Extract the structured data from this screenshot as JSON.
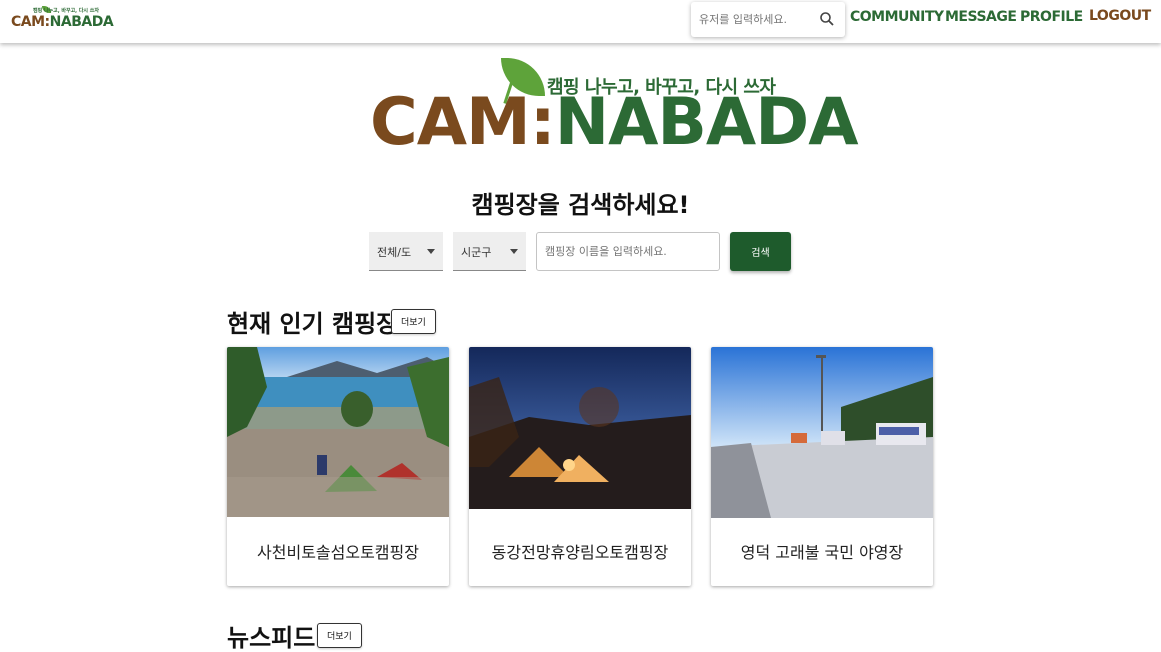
{
  "header": {
    "logo_tagline": "캠핑 나누고, 바꾸고, 다시 쓰자",
    "logo_part1": "CAM:",
    "logo_part2": "NABADA",
    "user_search_placeholder": "유저를 입력하세요.",
    "nav": {
      "community": "COMMUNITY",
      "message": "MESSAGE",
      "profile": "PROFILE",
      "logout": "LOGOUT"
    }
  },
  "hero": {
    "tagline": "캠핑 나누고, 바꾸고, 다시 쓰자",
    "logo_part1": "CAM:",
    "logo_part2": "NABADA",
    "title": "캠핑장을 검색하세요!"
  },
  "search": {
    "province_selected": "전체/도",
    "city_selected": "시군구",
    "name_placeholder": "캠핑장 이름을 입력하세요.",
    "button_label": "검색"
  },
  "popular": {
    "title": "현재 인기 캠핑장",
    "more_label": "더보기",
    "cards": [
      {
        "name": "사천비토솔섬오토캠핑장"
      },
      {
        "name": "동강전망휴양림오토캠핑장"
      },
      {
        "name": "영덕 고래불 국민 야영장"
      }
    ]
  },
  "newsfeed": {
    "title": "뉴스피드",
    "more_label": "더보기"
  },
  "colors": {
    "brand_green": "#2c6a35",
    "brand_brown": "#7a4a1e",
    "button_green": "#1e5b2c"
  },
  "icons": {
    "user_search": "search-icon"
  }
}
